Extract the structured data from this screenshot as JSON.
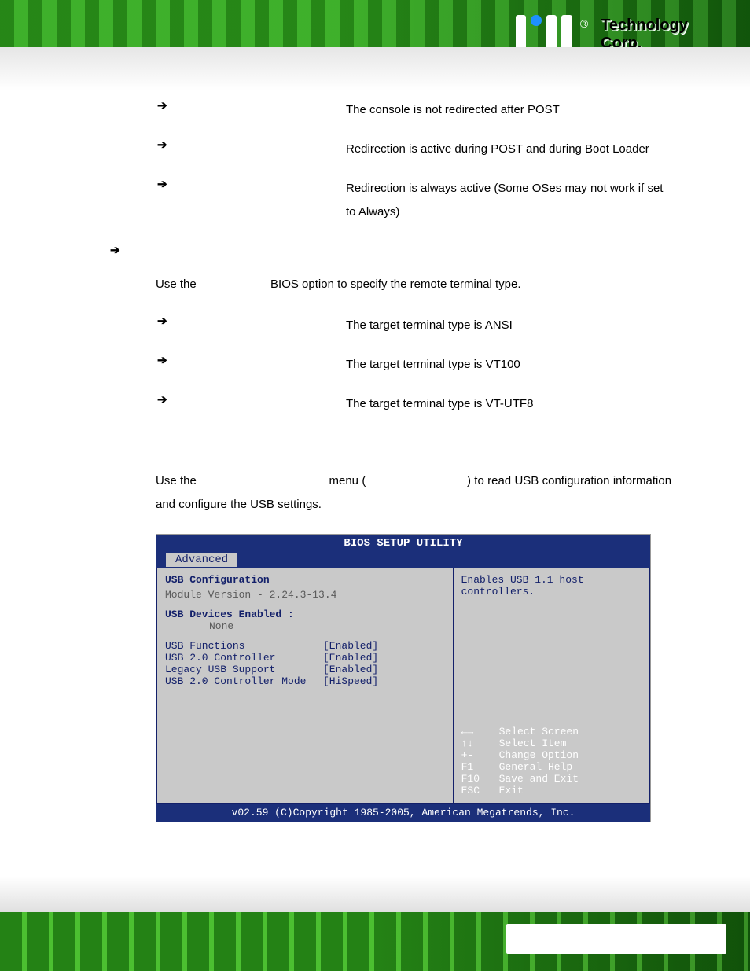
{
  "header": {
    "brand": "Technology Corp."
  },
  "redir_opts": [
    {
      "text": "The console is not redirected after POST"
    },
    {
      "text": "Redirection is active during POST and during Boot Loader"
    },
    {
      "text": "Redirection is always active (Some OSes may not work if set to Always)"
    }
  ],
  "terminal_intro": {
    "pre": "Use the",
    "post": "BIOS option to specify the remote terminal type."
  },
  "term_opts": [
    {
      "text": "The target terminal type is ANSI"
    },
    {
      "text": "The target terminal type is VT100"
    },
    {
      "text": "The target terminal type is VT-UTF8"
    }
  ],
  "usb_intro": {
    "pre": "Use  the",
    "mid": "menu  (",
    "post": ")  to  read  USB  configuration information and configure the USB settings."
  },
  "bios": {
    "title": "BIOS SETUP UTILITY",
    "tab": "Advanced",
    "section": "USB Configuration",
    "module": "Module Version - 2.24.3-13.4",
    "dev_label": "USB Devices Enabled :",
    "dev_value": "None",
    "rows": [
      {
        "k": "USB Functions",
        "v": "[Enabled]"
      },
      {
        "k": "USB 2.0 Controller",
        "v": "[Enabled]"
      },
      {
        "k": "Legacy USB Support",
        "v": "[Enabled]"
      },
      {
        "k": "USB 2.0 Controller Mode",
        "v": "[HiSpeed]"
      }
    ],
    "help_top": "Enables USB 1.1 host controllers.",
    "help_keys": [
      {
        "key": "←→",
        "label": "Select Screen"
      },
      {
        "key": "↑↓",
        "label": "Select Item"
      },
      {
        "key": "+-",
        "label": "Change Option"
      },
      {
        "key": "F1",
        "label": "General Help"
      },
      {
        "key": "F10",
        "label": "Save and Exit"
      },
      {
        "key": "ESC",
        "label": "Exit"
      }
    ],
    "footer": "v02.59 (C)Copyright 1985-2005, American Megatrends, Inc."
  }
}
